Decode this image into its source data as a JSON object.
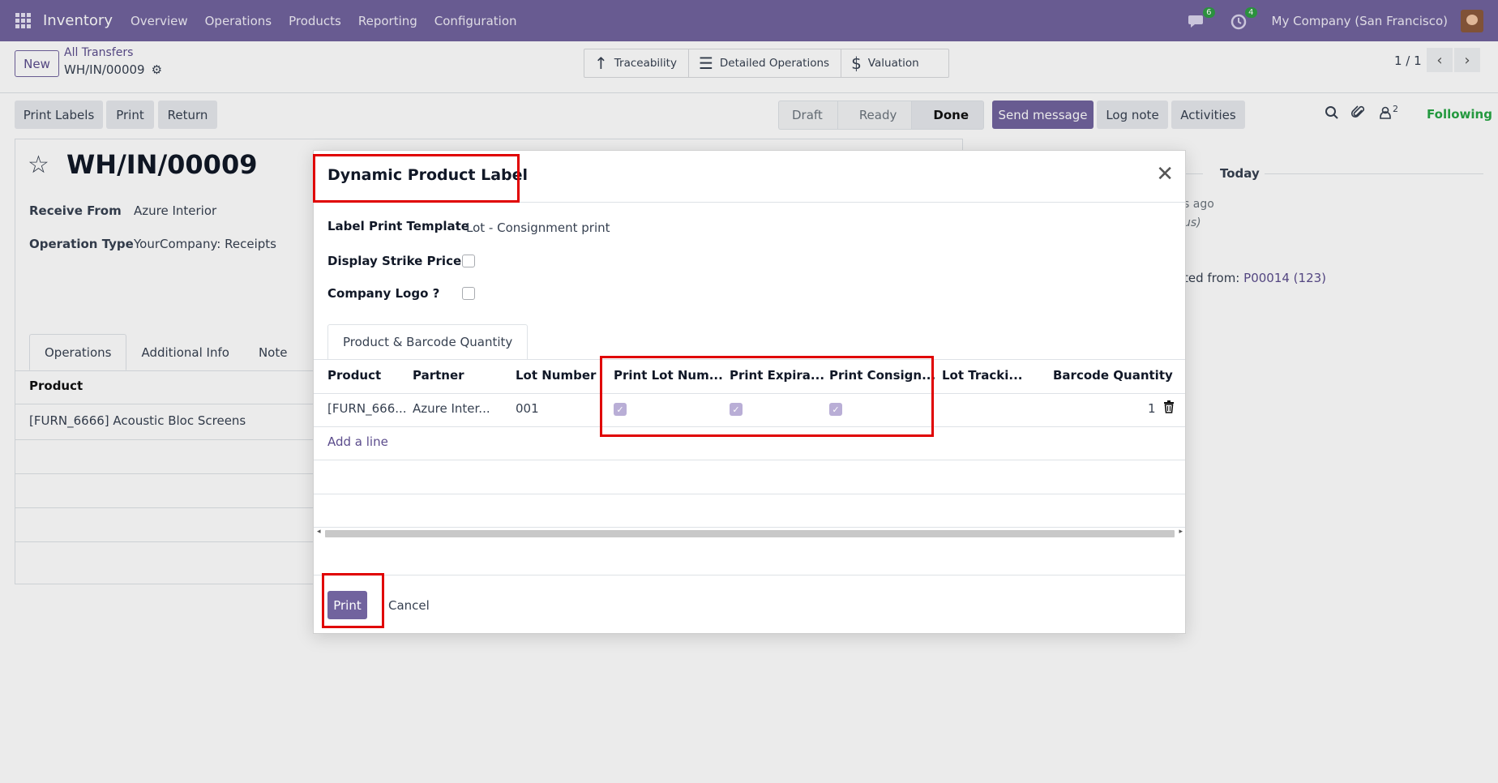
{
  "navbar": {
    "app_name": "Inventory",
    "menu": [
      "Overview",
      "Operations",
      "Products",
      "Reporting",
      "Configuration"
    ],
    "messages_count": "6",
    "activities_count": "4",
    "company": "My Company (San Francisco)"
  },
  "control": {
    "new_label": "New",
    "breadcrumb_parent": "All Transfers",
    "breadcrumb_current": "WH/IN/00009",
    "smart_buttons": [
      "Traceability",
      "Detailed Operations",
      "Valuation"
    ],
    "pager": "1 / 1"
  },
  "form": {
    "actions": [
      "Print Labels",
      "Print",
      "Return"
    ],
    "statuses": [
      "Draft",
      "Ready",
      "Done"
    ],
    "active_status": "Done",
    "title": "WH/IN/00009",
    "receive_from_label": "Receive From",
    "receive_from_value": "Azure Interior",
    "operation_type_label": "Operation Type",
    "operation_type_value": "YourCompany: Receipts",
    "tabs": [
      "Operations",
      "Additional Info",
      "Note"
    ],
    "table_header_product": "Product",
    "table_row_product": "[FURN_6666] Acoustic Bloc Screens"
  },
  "chatter": {
    "send_message": "Send message",
    "log_note": "Log note",
    "activities": "Activities",
    "followers_count": "2",
    "following": "Following",
    "today": "Today",
    "ago_text": "s ago",
    "italic_text": "us)",
    "created_from_text": "ted from:",
    "created_from_link": "P00014 (123)"
  },
  "modal": {
    "title": "Dynamic Product Label",
    "label_template_label": "Label Print Template",
    "label_template_value": "Lot - Consignment print",
    "strike_price_label": "Display Strike Price ?",
    "company_logo_label": "Company Logo ?",
    "tab": "Product & Barcode Quantity",
    "columns": [
      "Product",
      "Partner",
      "Lot Number",
      "Print Lot Num...",
      "Print Expira...",
      "Print Consign...",
      "Lot Tracki...",
      "Barcode Quantity"
    ],
    "row": {
      "product": "[FURN_666...",
      "partner": "Azure Inter...",
      "lot_number": "001",
      "barcode_quantity": "1"
    },
    "add_line": "Add a line",
    "print_label": "Print",
    "cancel_label": "Cancel"
  },
  "colors": {
    "navbar": "#71639e",
    "primary": "#71639e",
    "highlight": "#e00000"
  }
}
